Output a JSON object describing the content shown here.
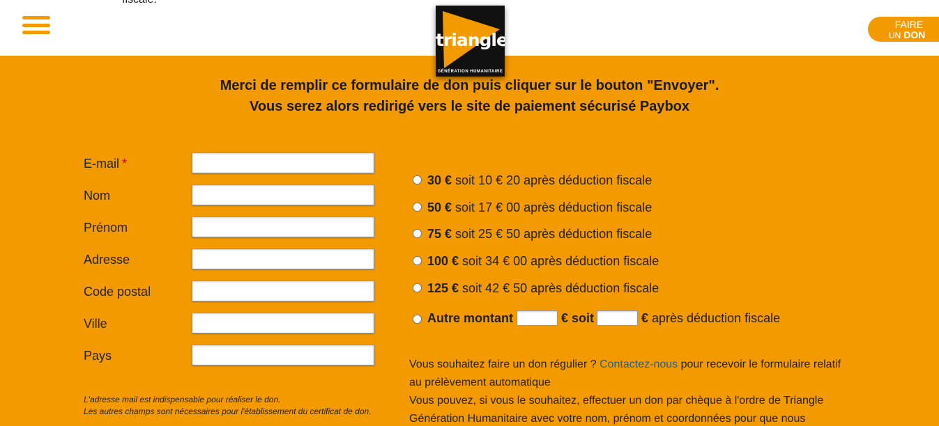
{
  "header": {
    "overflow_text": "fiscale.",
    "logo_word": "triangle",
    "logo_tagline": "GÉNÉRATION HUMANITAIRE",
    "donate_line1": "FAIRE",
    "donate_un": "UN",
    "donate_don": "DON"
  },
  "intro": {
    "line1": "Merci de remplir ce formulaire de don puis cliquer sur le bouton \"Envoyer\".",
    "line2": "Vous serez alors redirigé vers le site de paiement sécurisé Paybox"
  },
  "form": {
    "required_mark": "*",
    "fields": [
      {
        "label": "E-mail",
        "value": ""
      },
      {
        "label": "Nom",
        "value": ""
      },
      {
        "label": "Prénom",
        "value": ""
      },
      {
        "label": "Adresse",
        "value": ""
      },
      {
        "label": "Code postal",
        "value": ""
      },
      {
        "label": "Ville",
        "value": ""
      },
      {
        "label": "Pays",
        "value": ""
      }
    ],
    "note_line1": "L'adresse mail est indispensable pour réaliser le don.",
    "note_line2": "Les autres champs sont nécessaires pour l'établissement du certificat de don."
  },
  "amounts": [
    {
      "amount": "30 €",
      "rest": " soit 10 € 20 après déduction fiscale"
    },
    {
      "amount": "50 €",
      "rest": " soit 17 € 00 après déduction fiscale"
    },
    {
      "amount": "75 €",
      "rest": " soit 25 € 50 après déduction fiscale"
    },
    {
      "amount": "100 €",
      "rest": " soit 34 € 00 après déduction fiscale"
    },
    {
      "amount": "125 €",
      "rest": " soit 42 € 50 après déduction fiscale"
    }
  ],
  "other": {
    "label": "Autre montant",
    "euro_soit": "€ soit",
    "euro": "€",
    "after": "après déduction fiscale"
  },
  "info": {
    "p1_before": "Vous souhaitez faire un don régulier ? ",
    "p1_link": "Contactez-nous",
    "p1_after": " pour recevoir le formulaire relatif au prélèvement automatique",
    "p2": "Vous pouvez, si vous le souhaitez, effectuer un don par chèque à l'ordre de Triangle Génération Humanitaire avec votre nom, prénom et coordonnées pour que nous"
  },
  "colors": {
    "brand_orange": "#f39a00",
    "link_blue": "#1e5f96",
    "required_red": "#d0021b"
  }
}
